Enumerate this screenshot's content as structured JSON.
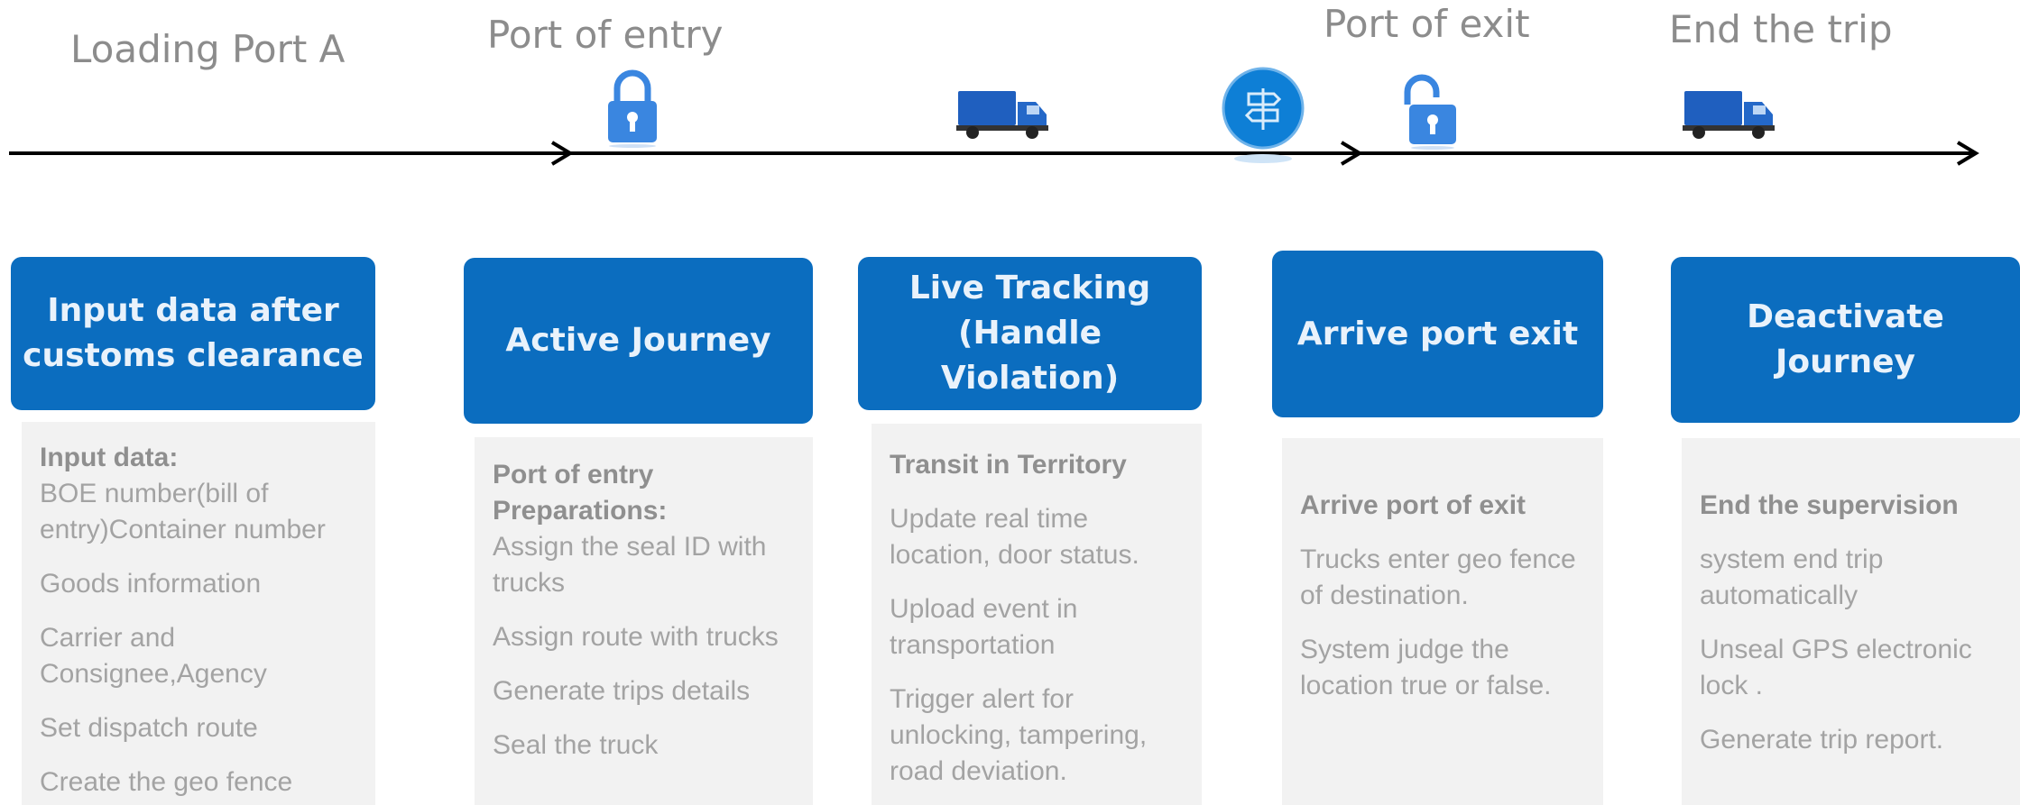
{
  "timeline": {
    "stages": [
      "Loading Port A",
      "Port of entry",
      "Port of exit",
      "End the trip"
    ],
    "icons": [
      "padlock-locked-icon",
      "truck-icon",
      "route-signpost-icon",
      "padlock-unlocked-icon",
      "truck-icon"
    ],
    "colors": {
      "accent": "#0b6dbf",
      "panel": "#f2f2f2",
      "text": "#a3a3a3"
    }
  },
  "steps": [
    {
      "header": "Input data after customs clearance",
      "title": "Input data:",
      "items": [
        "BOE number(bill of entry)Container number",
        "Goods information",
        "Carrier and Consignee,Agency",
        "Set dispatch route",
        "Create the geo fence"
      ]
    },
    {
      "header": "Active Journey",
      "title": "Port of  entry Preparations:",
      "items": [
        "Assign the seal ID with trucks",
        "Assign route with trucks",
        "Generate trips details",
        "Seal the truck"
      ]
    },
    {
      "header": "Live Tracking (Handle Violation)",
      "title": "Transit in Territory",
      "items": [
        "Update real time location, door status.",
        "Upload event in transportation",
        "Trigger alert for unlocking, tampering, road deviation."
      ]
    },
    {
      "header": "Arrive port exit",
      "title": "Arrive port of exit",
      "items": [
        "Trucks enter geo fence of destination.",
        "System judge the location true or false."
      ]
    },
    {
      "header": "Deactivate Journey",
      "title": "End the supervision",
      "items": [
        "system end trip automatically",
        "Unseal GPS electronic lock .",
        "Generate trip report."
      ]
    }
  ]
}
